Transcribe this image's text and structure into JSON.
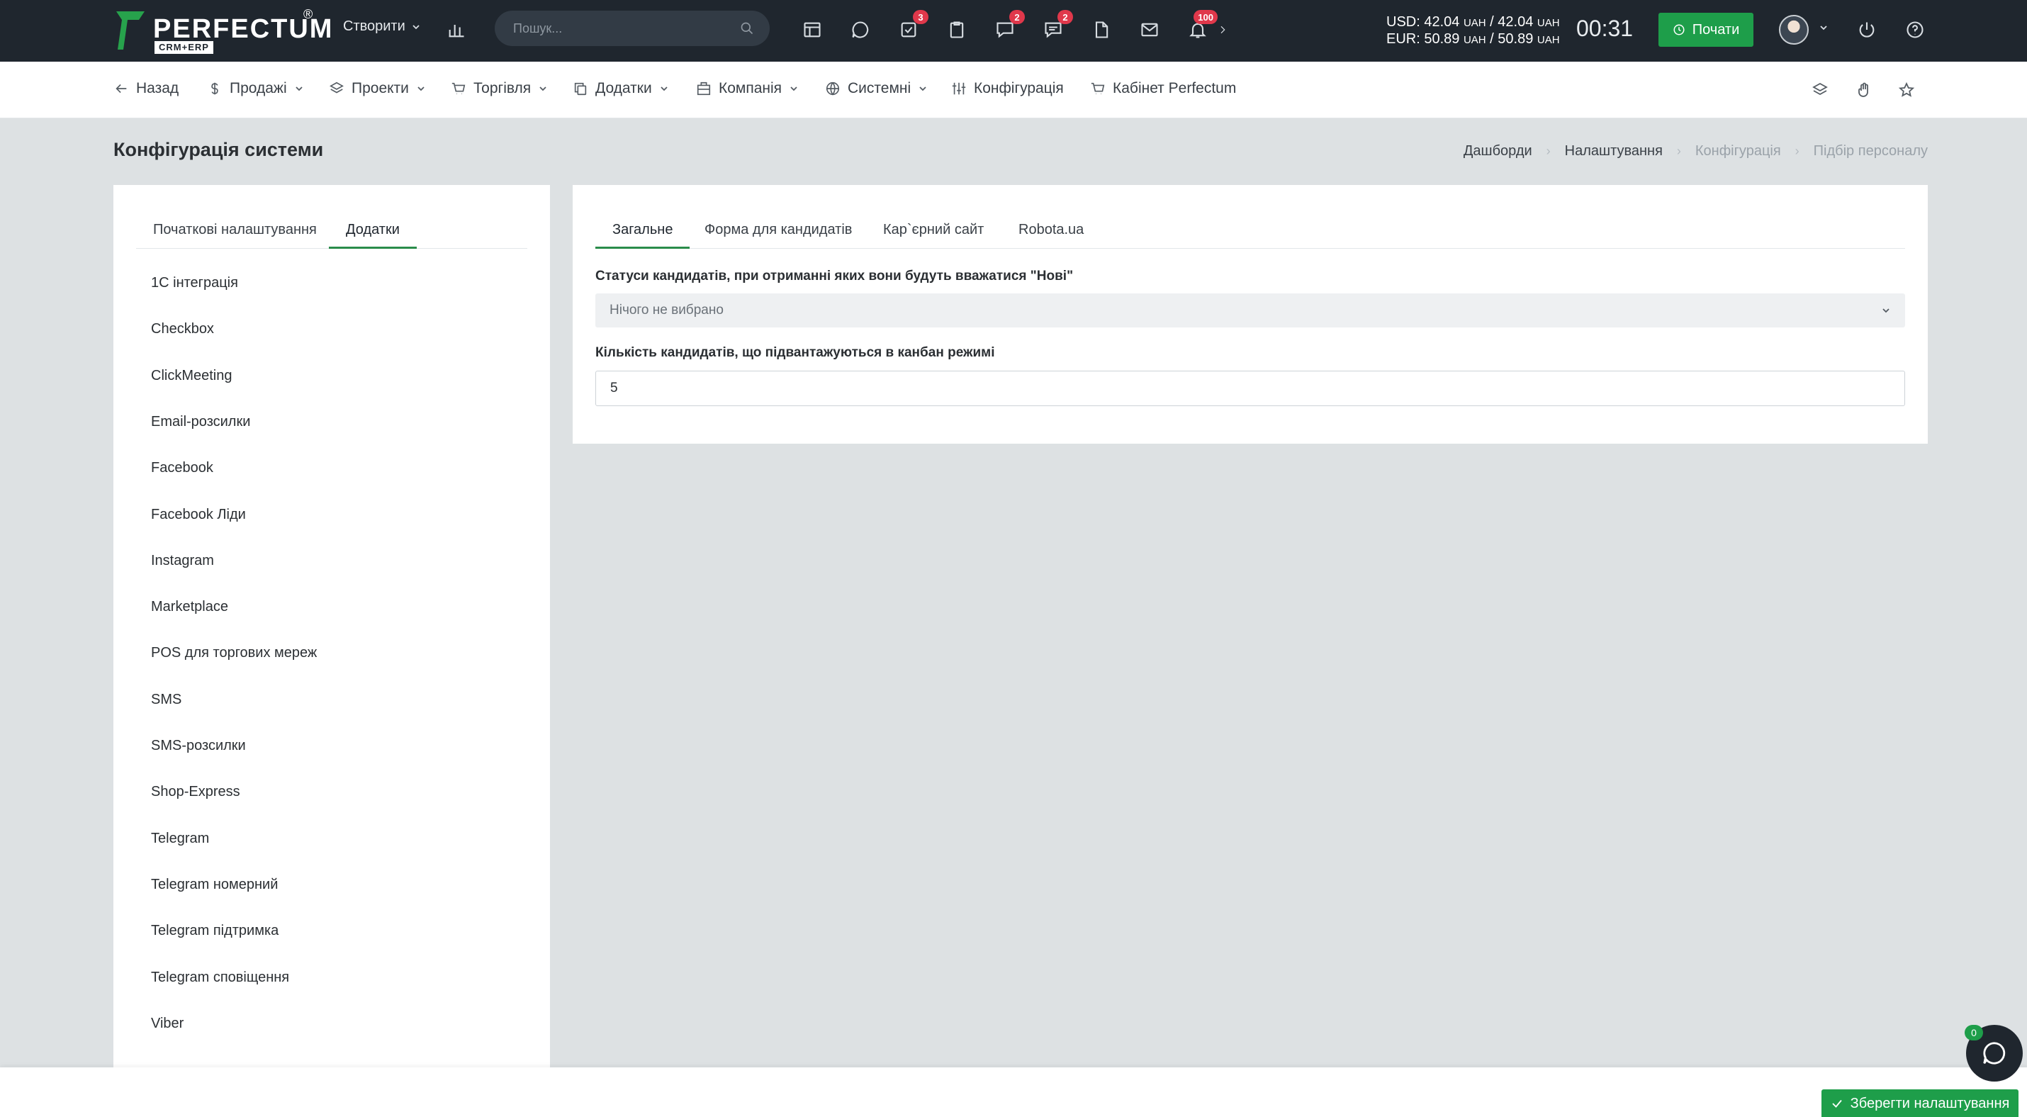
{
  "brand": {
    "name": "PERFECTUM",
    "tagline": "CRM+ERP",
    "reg_mark": "®"
  },
  "topbar": {
    "create_label": "Створити",
    "search_placeholder": "Пошук...",
    "badges": {
      "tasks": "3",
      "chat": "2",
      "messages": "2",
      "notifications": "100"
    },
    "currency_usd": "USD: 42.04",
    "currency_usd_sell": "42.04",
    "currency_eur": "EUR: 50.89",
    "currency_eur_sell": "50.89",
    "currency_unit": "UAH",
    "timer": "00:31",
    "start_label": "Почати"
  },
  "nav": {
    "back": "Назад",
    "items": [
      "Продажі",
      "Проекти",
      "Торгівля",
      "Додатки",
      "Компанія",
      "Системні",
      "Конфігурація",
      "Кабінет Perfectum"
    ]
  },
  "page": {
    "title": "Конфігурація системи",
    "breadcrumb": [
      "Дашборди",
      "Налаштування",
      "Конфігурація",
      "Підбір персоналу"
    ]
  },
  "left_panel": {
    "tabs": [
      "Початкові налаштування",
      "Додатки"
    ],
    "active_tab": 1,
    "items": [
      "1С інтеграція",
      "Checkbox",
      "ClickMeeting",
      "Email-розсилки",
      "Facebook",
      "Facebook Ліди",
      "Instagram",
      "Marketplace",
      "POS для торгових мереж",
      "SMS",
      "SMS-розсилки",
      "Shop-Express",
      "Telegram",
      "Telegram номерний",
      "Telegram підтримка",
      "Telegram сповіщення",
      "Viber"
    ]
  },
  "right_panel": {
    "tabs": [
      "Загальне",
      "Форма для кандидатів",
      "Кар`єрний сайт",
      "Robota.ua"
    ],
    "active_tab": 0,
    "status_label": "Статуси кандидатів, при отриманні яких вони будуть вважатися \"Нові\"",
    "status_value": "Нічого не вибрано",
    "kanban_label": "Кількість кандидатів, що підвантажуються в канбан режимі",
    "kanban_value": "5"
  },
  "footer": {
    "save_label": "Зберегти налаштування",
    "chat_count": "0"
  },
  "colors": {
    "topbar": "#1f262e",
    "accent_green": "#1e9e4a",
    "badge_red": "#e0384b",
    "background": "#dde1e3"
  }
}
